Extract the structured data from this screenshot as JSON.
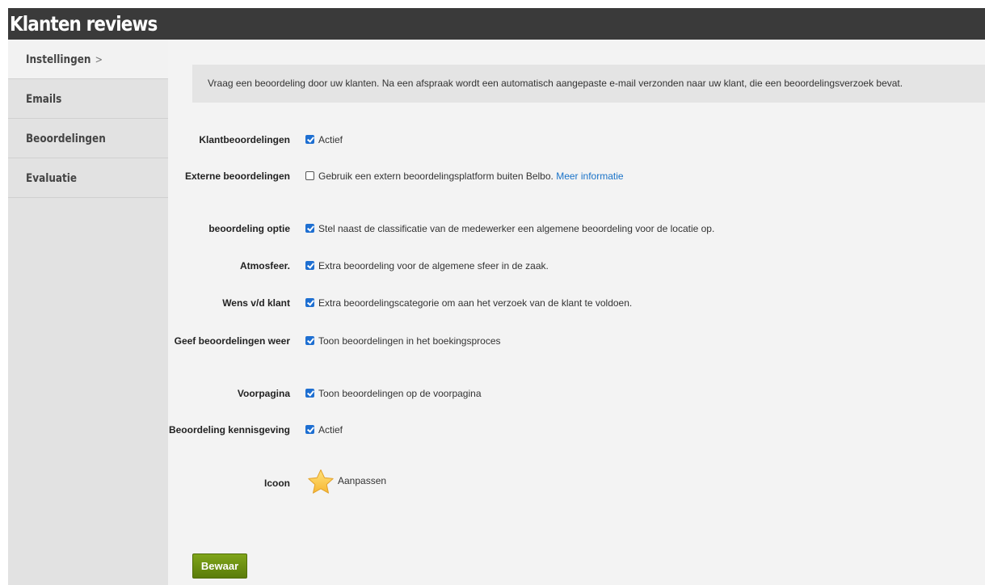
{
  "header": {
    "title": "Klanten reviews"
  },
  "sidebar": {
    "items": [
      {
        "label": "Instellingen",
        "chevron": ">"
      },
      {
        "label": "Emails"
      },
      {
        "label": "Beoordelingen"
      },
      {
        "label": "Evaluatie"
      }
    ]
  },
  "intro": "Vraag een beoordeling door uw klanten. Na een afspraak wordt een automatisch aangepaste e-mail verzonden naar uw klant, die een beoordelingsverzoek bevat.",
  "settings": [
    {
      "label": "Klantbeoordelingen",
      "checked": true,
      "text": "Actief"
    },
    {
      "label": "Externe beoordelingen",
      "checked": false,
      "text": "Gebruik een extern beoordelingsplatform buiten Belbo.",
      "link": "Meer informatie"
    },
    {
      "label": "beoordeling optie",
      "checked": true,
      "text": "Stel naast de classificatie van de medewerker een algemene beoordeling voor de locatie op."
    },
    {
      "label": "Atmosfeer.",
      "checked": true,
      "text": "Extra beoordeling voor de algemene sfeer in de zaak."
    },
    {
      "label": "Wens v/d klant",
      "checked": true,
      "text": "Extra beoordelingscategorie om aan het verzoek van de klant te voldoen."
    },
    {
      "label": "Geef beoordelingen weer",
      "checked": true,
      "text": "Toon beoordelingen in het boekingsproces"
    },
    {
      "label": "Voorpagina",
      "checked": true,
      "text": "Toon beoordelingen op de voorpagina"
    },
    {
      "label": "Beoordeling kennisgeving",
      "checked": true,
      "text": "Actief"
    }
  ],
  "icon_row": {
    "label": "Icoon",
    "icon": "star-icon",
    "action": "Aanpassen"
  },
  "save_label": "Bewaar",
  "colors": {
    "accent": "#1e6fd1",
    "save": "#6b8f10",
    "header": "#3a3a3a",
    "link": "#1a73c8"
  }
}
